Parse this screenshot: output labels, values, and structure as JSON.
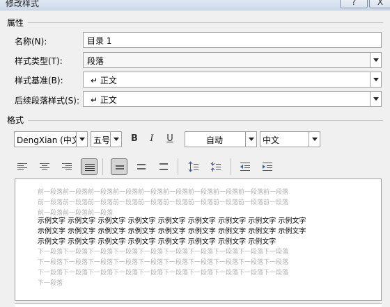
{
  "dialog": {
    "title": "修改样式",
    "help_label": "?",
    "close_label": "X"
  },
  "properties": {
    "section_label": "属性",
    "name_label": "名称(N):",
    "name_value": "目录 1",
    "style_type_label": "样式类型(T):",
    "style_type_value": "段落",
    "based_on_label": "样式基准(B):",
    "based_on_value": "↵ 正文",
    "next_style_label": "后续段落样式(S):",
    "next_style_value": "↵ 正文"
  },
  "format": {
    "section_label": "格式",
    "font_value": "DengXian (中文",
    "size_value": "五号",
    "bold_label": "B",
    "italic_label": "I",
    "underline_label": "U",
    "color_value": "自动",
    "language_value": "中文"
  },
  "preview": {
    "prev_lines": [
      "前一段落前一段落前一段落前一段落前一段落前一段落前一段落前一段落前一段落前一段落",
      "前一段落前一段落前一段落前一段落前一段落前一段落前一段落前一段落前一段落前一段落",
      "前一段落前一段落前一段落"
    ],
    "sample_lines": [
      "示例文字  示例文字  示例文字  示例文字  示例文字  示例文字  示例文字  示例文字  示例文字",
      "示例文字  示例文字  示例文字  示例文字  示例文字  示例文字  示例文字  示例文字  示例文字",
      "示例文字  示例文字  示例文字  示例文字  示例文字  示例文字  示例文字  示例文字"
    ],
    "next_lines": [
      "下一段落下一段落下一段落下一段落下一段落下一段落下一段落下一段落下一段落下一段落",
      "下一段落下一段落下一段落下一段落下一段落下一段落下一段落下一段落下一段落下一段落",
      "下一段落下一段落下一段落下一段落下一段落下一段落下一段落下一段落下一段落下一段落",
      "下一段落"
    ]
  }
}
